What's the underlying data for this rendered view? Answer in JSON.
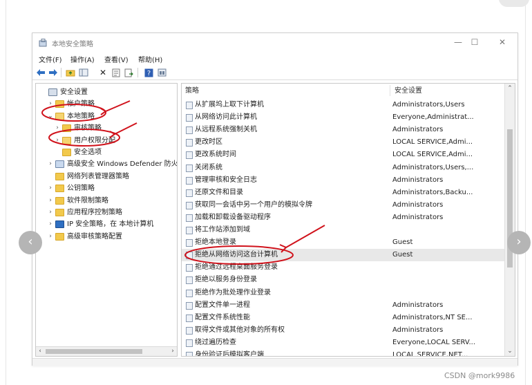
{
  "window": {
    "title": "本地安全策略",
    "controls": {
      "minimize": "—",
      "maximize": "☐",
      "close": "✕"
    }
  },
  "menu": [
    "文件(F)",
    "操作(A)",
    "查看(V)",
    "帮助(H)"
  ],
  "toolbar": {
    "icons": [
      "back-arrow-icon",
      "forward-arrow-icon",
      "up-folder-icon",
      "show-hide-tree-icon",
      "delete-icon",
      "properties-icon",
      "export-list-icon",
      "help-icon",
      "view-icon"
    ]
  },
  "tree": {
    "items": [
      {
        "label": "安全设置",
        "level": 0,
        "expander": "",
        "icon": "security-settings-icon"
      },
      {
        "label": "帐户策略",
        "level": 1,
        "expander": "›",
        "icon": "folder-icon"
      },
      {
        "label": "本地策略",
        "level": 1,
        "expander": "⌄",
        "icon": "folder-open-icon"
      },
      {
        "label": "审核策略",
        "level": 2,
        "expander": "›",
        "icon": "folder-icon"
      },
      {
        "label": "用户权限分配",
        "level": 2,
        "expander": "›",
        "icon": "folder-open-icon"
      },
      {
        "label": "安全选项",
        "level": 2,
        "expander": "",
        "icon": "folder-icon"
      },
      {
        "label": "高级安全 Windows Defender 防火墙",
        "level": 1,
        "expander": "›",
        "icon": "firewall-icon"
      },
      {
        "label": "网络列表管理器策略",
        "level": 1,
        "expander": "",
        "icon": "folder-icon"
      },
      {
        "label": "公钥策略",
        "level": 1,
        "expander": "›",
        "icon": "folder-icon"
      },
      {
        "label": "软件限制策略",
        "level": 1,
        "expander": "›",
        "icon": "folder-icon"
      },
      {
        "label": "应用程序控制策略",
        "level": 1,
        "expander": "›",
        "icon": "folder-icon"
      },
      {
        "label": "IP 安全策略，在 本地计算机",
        "level": 1,
        "expander": "›",
        "icon": "ip-security-icon"
      },
      {
        "label": "高级审核策略配置",
        "level": 1,
        "expander": "›",
        "icon": "folder-icon"
      }
    ],
    "hscroll": {
      "left": "‹",
      "right": "›"
    }
  },
  "list": {
    "columns": [
      "策略",
      "安全设置"
    ],
    "sort_glyph": "⌃",
    "rows": [
      {
        "policy": "从扩展坞上取下计算机",
        "setting": "Administrators,Users"
      },
      {
        "policy": "从网络访问此计算机",
        "setting": "Everyone,Administrat..."
      },
      {
        "policy": "从远程系统强制关机",
        "setting": "Administrators"
      },
      {
        "policy": "更改时区",
        "setting": "LOCAL SERVICE,Admi..."
      },
      {
        "policy": "更改系统时间",
        "setting": "LOCAL SERVICE,Admi..."
      },
      {
        "policy": "关闭系统",
        "setting": "Administrators,Users,..."
      },
      {
        "policy": "管理审核和安全日志",
        "setting": "Administrators"
      },
      {
        "policy": "还原文件和目录",
        "setting": "Administrators,Backu..."
      },
      {
        "policy": "获取同一会话中另一个用户的模拟令牌",
        "setting": "Administrators"
      },
      {
        "policy": "加载和卸载设备驱动程序",
        "setting": "Administrators"
      },
      {
        "policy": "将工作站添加到域",
        "setting": ""
      },
      {
        "policy": "拒绝本地登录",
        "setting": "Guest"
      },
      {
        "policy": "拒绝从网络访问这台计算机",
        "setting": "Guest"
      },
      {
        "policy": "拒绝通过远程桌面服务登录",
        "setting": ""
      },
      {
        "policy": "拒绝以服务身份登录",
        "setting": ""
      },
      {
        "policy": "拒绝作为批处理作业登录",
        "setting": ""
      },
      {
        "policy": "配置文件单一进程",
        "setting": "Administrators"
      },
      {
        "policy": "配置文件系统性能",
        "setting": "Administrators,NT SE..."
      },
      {
        "policy": "取得文件或其他对象的所有权",
        "setting": "Administrators"
      },
      {
        "policy": "绕过遍历检查",
        "setting": "Everyone,LOCAL SERV..."
      },
      {
        "policy": "身份验证后模拟客户端",
        "setting": "LOCAL SERVICE,NET..."
      }
    ],
    "selected_index": 12,
    "vscroll": {
      "up": "⌃",
      "down": "⌄"
    }
  },
  "carousel": {
    "prev": "‹",
    "next": "›"
  },
  "watermark": "CSDN @mork9986",
  "colors": {
    "annotation": "#d0121b",
    "selection": "#e8e8e8",
    "folder": "#f2c94c"
  }
}
